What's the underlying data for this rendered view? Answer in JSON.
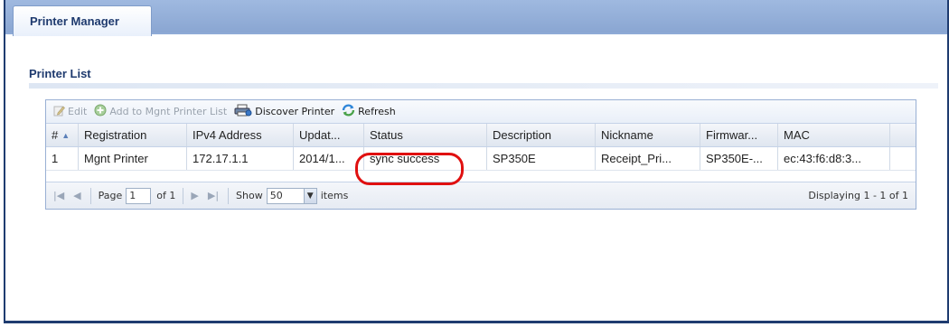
{
  "tab": {
    "label": "Printer Manager"
  },
  "section": {
    "title": "Printer List"
  },
  "toolbar": {
    "edit": "Edit",
    "add_to_mgnt": "Add to Mgnt Printer List",
    "discover": "Discover Printer",
    "refresh": "Refresh"
  },
  "table": {
    "columns": [
      "#",
      "Registration",
      "IPv4 Address",
      "Updat...",
      "Status",
      "Description",
      "Nickname",
      "Firmwar...",
      "MAC"
    ],
    "rows": [
      [
        "1",
        "Mgnt Printer",
        "172.17.1.1",
        "2014/1...",
        "sync success",
        "SP350E",
        "Receipt_Pri...",
        "SP350E-...",
        "ec:43:f6:d8:3..."
      ]
    ]
  },
  "pager": {
    "page_label": "Page",
    "page_value": "1",
    "of_label": "of 1",
    "show_label": "Show",
    "show_value": "50",
    "items_label": "items",
    "display_text": "Displaying 1 - 1 of 1"
  }
}
